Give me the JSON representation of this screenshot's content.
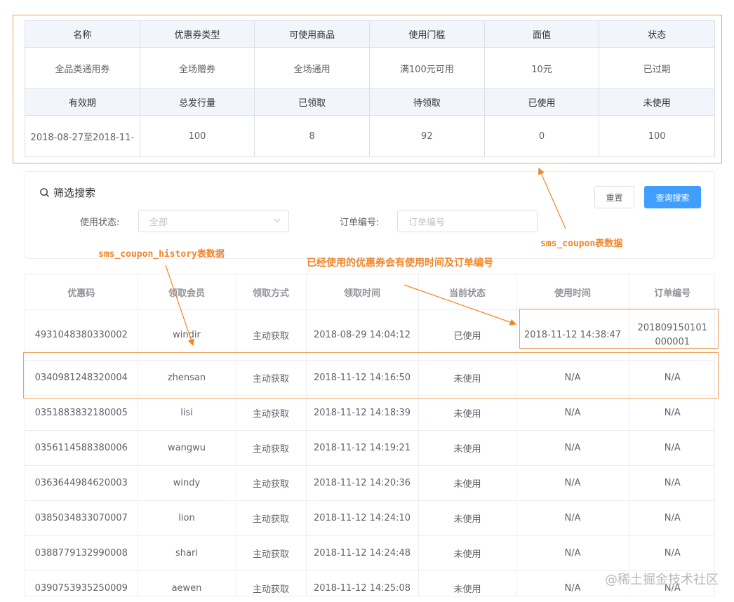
{
  "coupon_table": {
    "headers_1": [
      "名称",
      "优惠券类型",
      "可使用商品",
      "使用门槛",
      "面值",
      "状态"
    ],
    "values_1": [
      "全品类通用券",
      "全场赠券",
      "全场通用",
      "满100元可用",
      "10元",
      "已过期"
    ],
    "headers_2": [
      "有效期",
      "总发行量",
      "已领取",
      "待领取",
      "已使用",
      "未使用"
    ],
    "values_2": [
      "2018-08-27至2018-11-",
      "100",
      "8",
      "92",
      "0",
      "100"
    ]
  },
  "filter": {
    "title": "筛选搜索",
    "reset_label": "重置",
    "search_label": "查询搜索",
    "status_label": "使用状态:",
    "status_value": "全部",
    "order_label": "订单编号:",
    "order_placeholder": "订单编号"
  },
  "history_table": {
    "columns": [
      "优惠码",
      "领取会员",
      "领取方式",
      "领取时间",
      "当前状态",
      "使用时间",
      "订单编号"
    ],
    "rows": [
      [
        "4931048380330002",
        "windir",
        "主动获取",
        "2018-08-29 14:04:12",
        "已使用",
        "2018-11-12 14:38:47",
        "201809150101000001"
      ],
      [
        "0340981248320004",
        "zhensan",
        "主动获取",
        "2018-11-12 14:16:50",
        "未使用",
        "N/A",
        "N/A"
      ],
      [
        "0351883832180005",
        "lisi",
        "主动获取",
        "2018-11-12 14:18:39",
        "未使用",
        "N/A",
        "N/A"
      ],
      [
        "0356114588380006",
        "wangwu",
        "主动获取",
        "2018-11-12 14:19:21",
        "未使用",
        "N/A",
        "N/A"
      ],
      [
        "0363644984620003",
        "windy",
        "主动获取",
        "2018-11-12 14:20:36",
        "未使用",
        "N/A",
        "N/A"
      ],
      [
        "0385034833070007",
        "lion",
        "主动获取",
        "2018-11-12 14:24:10",
        "未使用",
        "N/A",
        "N/A"
      ],
      [
        "0388779132990008",
        "shari",
        "主动获取",
        "2018-11-12 14:24:48",
        "未使用",
        "N/A",
        "N/A"
      ],
      [
        "0390753935250009",
        "aewen",
        "主动获取",
        "2018-11-12 14:25:08",
        "未使用",
        "N/A",
        "N/A"
      ]
    ]
  },
  "annotations": {
    "coupon_table_note": "sms_coupon表数据",
    "history_table_note": "sms_coupon_history表数据",
    "used_note": "已经使用的优惠券会有使用时间及订单编号"
  },
  "watermark": "@稀土掘金技术社区",
  "colors": {
    "annotation_orange": "#f0862a",
    "primary_blue": "#409eff",
    "header_bg": "#f2f6fc"
  }
}
